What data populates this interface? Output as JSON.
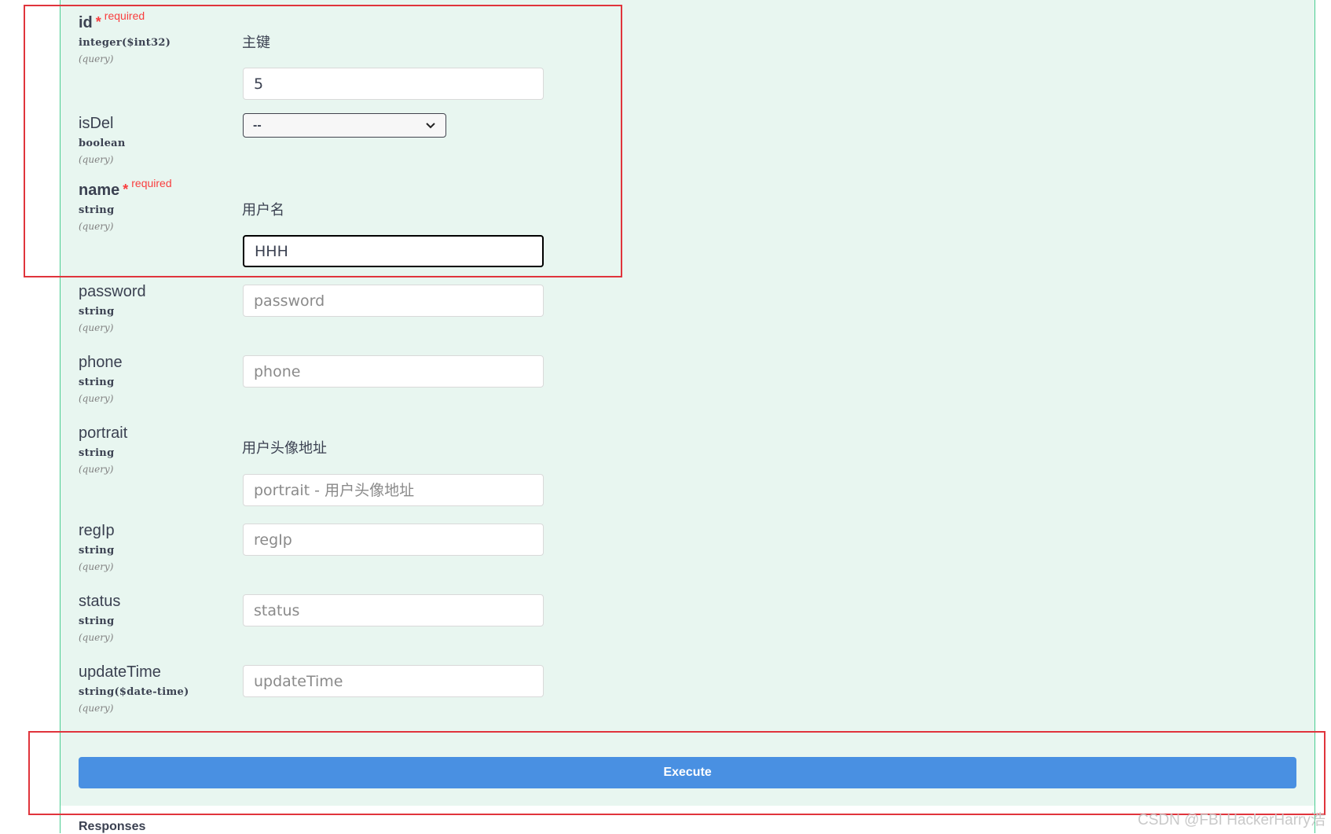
{
  "params": {
    "id": {
      "name": "id",
      "star": "*",
      "required": "required",
      "type": "integer($int32)",
      "in": "(query)",
      "description": "主键",
      "value": "5"
    },
    "isDel": {
      "name": "isDel",
      "type": "boolean",
      "in": "(query)",
      "selected": "--"
    },
    "name": {
      "name": "name",
      "star": "*",
      "required": "required",
      "type": "string",
      "in": "(query)",
      "description": "用户名",
      "value": "HHH"
    },
    "password": {
      "name": "password",
      "type": "string",
      "in": "(query)",
      "placeholder": "password"
    },
    "phone": {
      "name": "phone",
      "type": "string",
      "in": "(query)",
      "placeholder": "phone"
    },
    "portrait": {
      "name": "portrait",
      "type": "string",
      "in": "(query)",
      "description": "用户头像地址",
      "placeholder": "portrait - 用户头像地址"
    },
    "regIp": {
      "name": "regIp",
      "type": "string",
      "in": "(query)",
      "placeholder": "regIp"
    },
    "status": {
      "name": "status",
      "type": "string",
      "in": "(query)",
      "placeholder": "status"
    },
    "updateTime": {
      "name": "updateTime",
      "type": "string($date-time)",
      "in": "(query)",
      "placeholder": "updateTime"
    }
  },
  "execute_label": "Execute",
  "responses_label": "Responses",
  "watermark": "CSDN @FBI HackerHarry浩",
  "colors": {
    "panel_bg": "#e8f6f0",
    "panel_border": "#49cc90",
    "execute_bg": "#4990e2",
    "required": "#f93e3e",
    "highlight_box": "#e0343c"
  }
}
